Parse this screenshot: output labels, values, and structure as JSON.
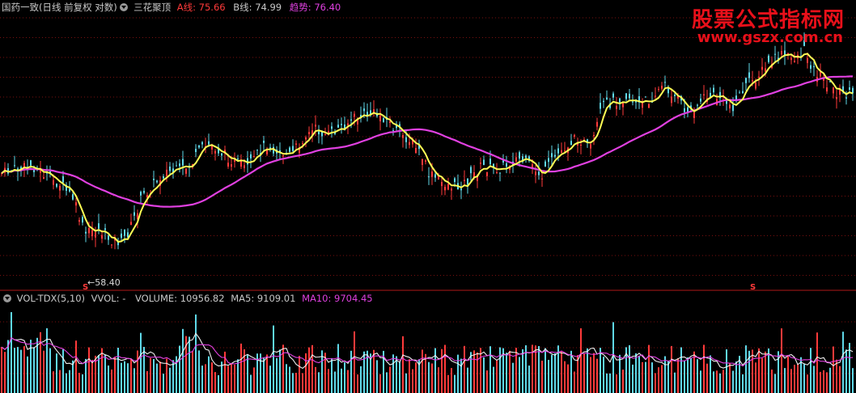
{
  "header": {
    "title": "国药一致(日线 前复权 对数)",
    "indicator": "三花聚顶",
    "a_label": "A线:",
    "a_value": "75.66",
    "b_label": "B线:",
    "b_value": "74.99",
    "trend_label": "趋势:",
    "trend_value": "76.40"
  },
  "watermark": {
    "line1": "股票公式指标网",
    "line2": "www.gszx.com.cn"
  },
  "annotations": {
    "low_label": "←58.40",
    "signal_mark": "S"
  },
  "volume_header": {
    "name": "VOL-TDX(5,10)",
    "vvol": "VVOL: -",
    "volume_label": "VOLUME:",
    "volume_value": "10956.82",
    "ma5_label": "MA5:",
    "ma5_value": "9109.01",
    "ma10_label": "MA10:",
    "ma10_value": "9704.45"
  },
  "colors": {
    "up": "#ff3a3a",
    "down": "#5fd8e8",
    "yellow_line": "#ffff55",
    "pink_line": "#e040e0",
    "grid": "#7a1010",
    "divider": "#b01818",
    "text_gray": "#c8c8c8"
  },
  "chart_data": {
    "type": "candlestick",
    "price_low_marker": 58.4,
    "price_series": [
      {
        "name": "A线",
        "value": 75.66
      },
      {
        "name": "B线",
        "value": 74.99
      },
      {
        "name": "趋势",
        "value": 76.4
      }
    ],
    "volume_series": [
      {
        "name": "VOLUME",
        "value": 10956.82
      },
      {
        "name": "MA5",
        "value": 9109.01
      },
      {
        "name": "MA10",
        "value": 9704.45
      }
    ]
  }
}
